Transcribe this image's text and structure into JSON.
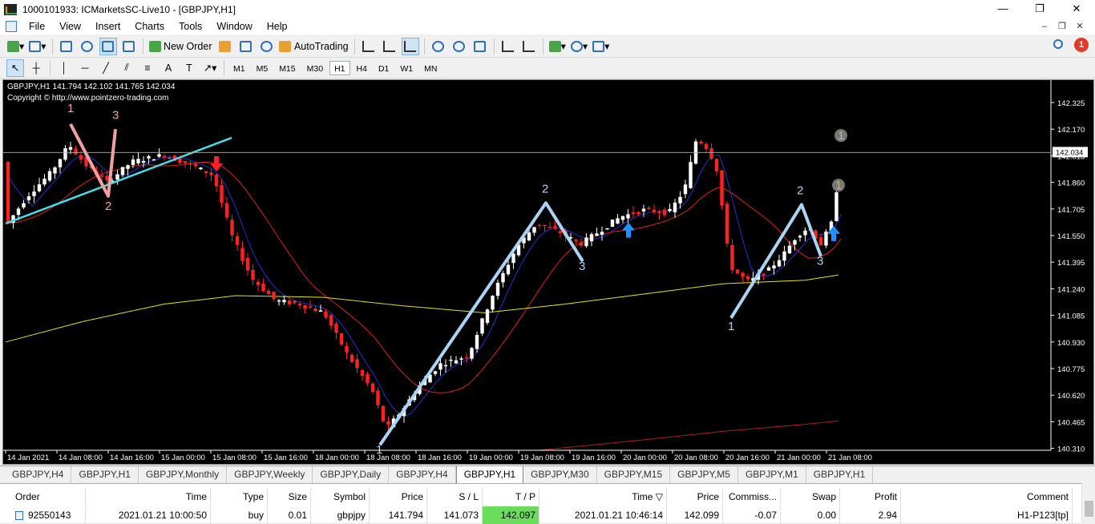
{
  "window": {
    "title": "1000101933: ICMarketsSC-Live10 - [GBPJPY,H1]",
    "buttons": {
      "minimize": "—",
      "maximize": "❐",
      "close": "✕"
    }
  },
  "menu": {
    "items": [
      "File",
      "View",
      "Insert",
      "Charts",
      "Tools",
      "Window",
      "Help"
    ],
    "mdi": {
      "minimize": "–",
      "restore": "❐",
      "close": "✕"
    }
  },
  "toolbar": {
    "new_order": "New Order",
    "autotrading": "AutoTrading",
    "notification_count": "1"
  },
  "timeframes": [
    "M1",
    "M5",
    "M15",
    "M30",
    "H1",
    "H4",
    "D1",
    "W1",
    "MN"
  ],
  "active_timeframe": "H1",
  "chart": {
    "info": "GBPJPY,H1  141.794 142.102 141.765 142.034",
    "copyright": "Copyright © http://www.pointzero-trading.com",
    "current_price": "142.034",
    "price_ticks": [
      "142.325",
      "142.170",
      "142.015",
      "141.860",
      "141.705",
      "141.550",
      "141.395",
      "141.240",
      "141.085",
      "140.930",
      "140.775",
      "140.620",
      "140.465",
      "140.310"
    ],
    "time_ticks": [
      "14 Jan 2021",
      "14 Jan 08:00",
      "14 Jan 16:00",
      "15 Jan 00:00",
      "15 Jan 08:00",
      "15 Jan 16:00",
      "18 Jan 00:00",
      "18 Jan 08:00",
      "18 Jan 16:00",
      "19 Jan 00:00",
      "19 Jan 08:00",
      "19 Jan 16:00",
      "20 Jan 00:00",
      "20 Jan 08:00",
      "20 Jan 16:00",
      "21 Jan 00:00",
      "21 Jan 08:00"
    ],
    "wave_labels": [
      "1",
      "2",
      "3",
      "1",
      "2",
      "3",
      "1",
      "2",
      "3",
      "1",
      "1"
    ],
    "colors": {
      "bull": "#ffffff",
      "bear": "#ff2020",
      "ma_fast": "#1e32d2",
      "ma_mid": "#e02020",
      "ma_slow": "#e6e600",
      "ma_long": "#b02020",
      "wave": "#a9d4f5",
      "wave_pink": "#f4a0a0",
      "trend": "#40e0f0",
      "arrow_up": "#1e90ff"
    }
  },
  "chart_tabs": [
    "GBPJPY,H4",
    "GBPJPY,H1",
    "GBPJPY,Monthly",
    "GBPJPY,Weekly",
    "GBPJPY,Daily",
    "GBPJPY,H4",
    "GBPJPY,H1",
    "GBPJPY,M30",
    "GBPJPY,M15",
    "GBPJPY,M5",
    "GBPJPY,M1",
    "GBPJPY,H1"
  ],
  "active_tab_index": 6,
  "terminal": {
    "headers": [
      "Order",
      "Time",
      "Type",
      "Size",
      "Symbol",
      "Price",
      "S / L",
      "T / P",
      "Time",
      "Price",
      "Commiss...",
      "Swap",
      "Profit",
      "Comment"
    ],
    "sort_indicator": "▽",
    "row": [
      "92550143",
      "2021.01.21 10:00:50",
      "buy",
      "0.01",
      "gbpjpy",
      "141.794",
      "141.073",
      "142.097",
      "2021.01.21 10:46:14",
      "142.099",
      "-0.07",
      "0.00",
      "2.94",
      "H1-P123[tp]"
    ]
  }
}
